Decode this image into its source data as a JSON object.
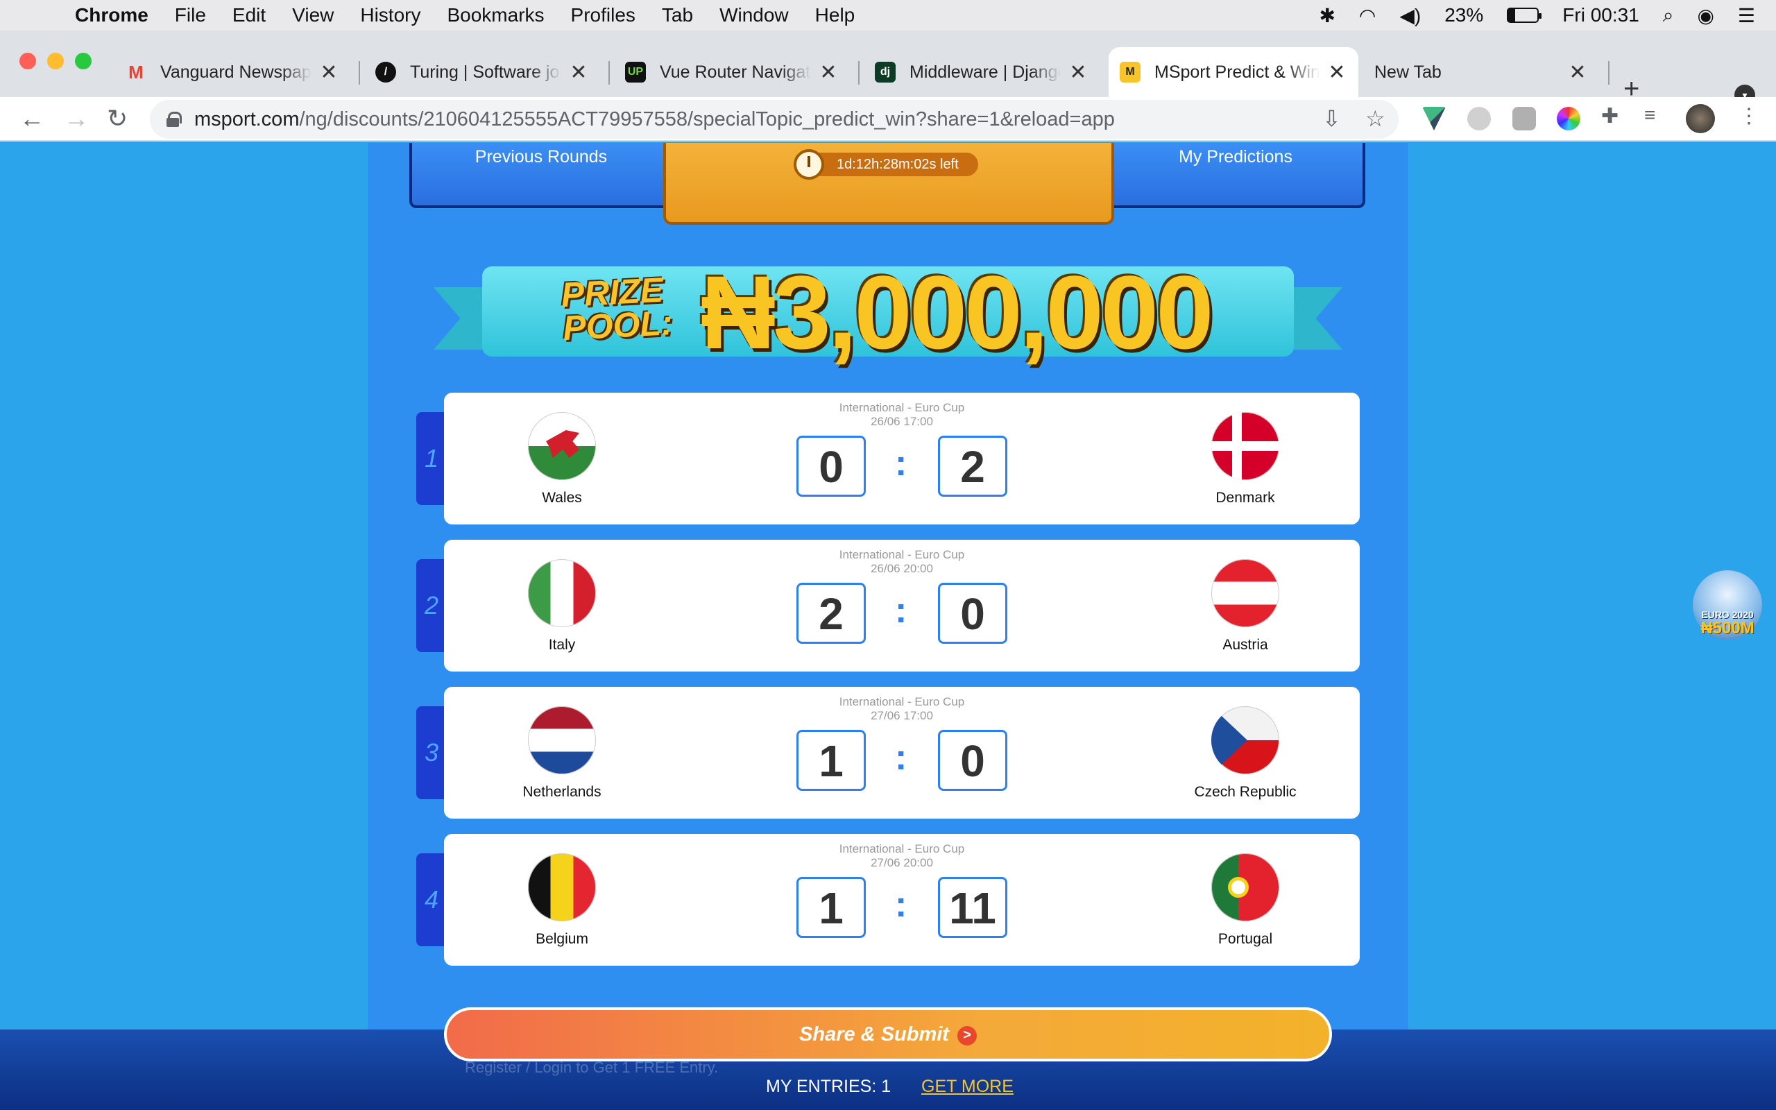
{
  "menubar": {
    "app": "Chrome",
    "items": [
      "File",
      "Edit",
      "View",
      "History",
      "Bookmarks",
      "Profiles",
      "Tab",
      "Window",
      "Help"
    ],
    "battery": "23%",
    "battery_level": 0.23,
    "clock": "Fri 00:31"
  },
  "tabs": [
    {
      "title": "Vanguard Newspapers",
      "favicon": "gmail-icon",
      "active": false
    },
    {
      "title": "Turing | Software jobs",
      "favicon": "turing-icon",
      "active": false
    },
    {
      "title": "Vue Router Navigation",
      "favicon": "upwork-icon",
      "active": false
    },
    {
      "title": "Middleware | Django",
      "favicon": "django-icon",
      "active": false
    },
    {
      "title": "MSport Predict & Win",
      "favicon": "msport-icon",
      "active": true
    },
    {
      "title": "New Tab",
      "favicon": "",
      "active": false
    }
  ],
  "address": {
    "host": "msport.com",
    "path": "/ng/discounts/210604125555ACT79957558/specialTopic_predict_win?share=1&reload=app"
  },
  "page": {
    "previous_rounds": "Previous Rounds",
    "my_predictions": "My Predictions",
    "timer": "1d:12h:28m:02s left",
    "prize_label_1": "PRIZE",
    "prize_label_2": "POOL:",
    "prize_amount": "₦3,000,000",
    "matches": [
      {
        "num": "1",
        "competition": "International - Euro Cup",
        "datetime": "26/06 17:00",
        "home": "Wales",
        "away": "Denmark",
        "home_score": "0",
        "away_score": "2"
      },
      {
        "num": "2",
        "competition": "International - Euro Cup",
        "datetime": "26/06 20:00",
        "home": "Italy",
        "away": "Austria",
        "home_score": "2",
        "away_score": "0"
      },
      {
        "num": "3",
        "competition": "International - Euro Cup",
        "datetime": "27/06 17:00",
        "home": "Netherlands",
        "away": "Czech Republic",
        "home_score": "1",
        "away_score": "0"
      },
      {
        "num": "4",
        "competition": "International - Euro Cup",
        "datetime": "27/06 20:00",
        "home": "Belgium",
        "away": "Portugal",
        "home_score": "1",
        "away_score": "11"
      }
    ],
    "submit_label": "Share & Submit",
    "footer_ghost": "Register / Login to Get 1 FREE Entry.",
    "entries": "MY ENTRIES: 1",
    "get_more": "GET MORE",
    "side_badge_1": "EURO 2020",
    "side_badge_2": "₦500M"
  }
}
